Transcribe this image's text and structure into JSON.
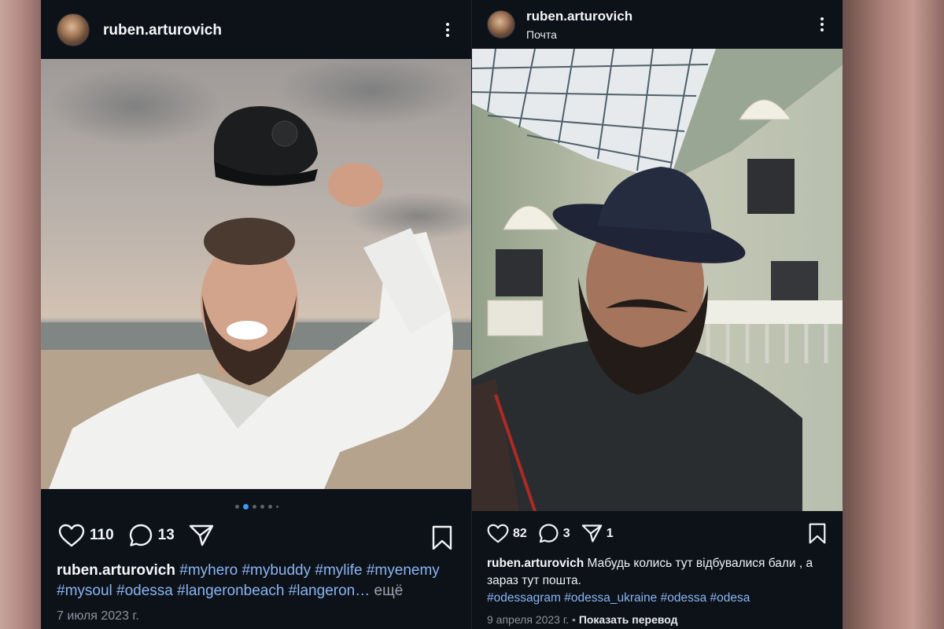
{
  "posts": [
    {
      "username": "ruben.arturovich",
      "likes": "110",
      "comments": "13",
      "caption_user": "ruben.arturovich",
      "hashtags_line1": "#myhero #mybuddy #mylife #myenemy",
      "hashtags_line2": "#mysoul #odessa #langeronbeach #langeron…",
      "more_label": "ещё",
      "date": "7 июля 2023 г.",
      "carousel_count": 6,
      "carousel_active": 2
    },
    {
      "username": "ruben.arturovich",
      "location": "Почта",
      "likes": "82",
      "comments": "3",
      "shares": "1",
      "caption_user": "ruben.arturovich",
      "caption_text": "Мабудь колись тут відбувалися бали , а зараз тут пошта.",
      "hashtags": "#odessagram #odessa_ukraine #odessa #odesa",
      "date": "9 апреля 2023 г.",
      "separator": "•",
      "translate_label": "Показать перевод"
    }
  ],
  "icons": [
    "heart-icon",
    "comment-icon",
    "send-icon",
    "bookmark-icon",
    "more-options-icon"
  ],
  "colors": {
    "background": "#0d1219",
    "hashtag": "#8ab4f2",
    "carousel_active": "#3b9cf5"
  }
}
